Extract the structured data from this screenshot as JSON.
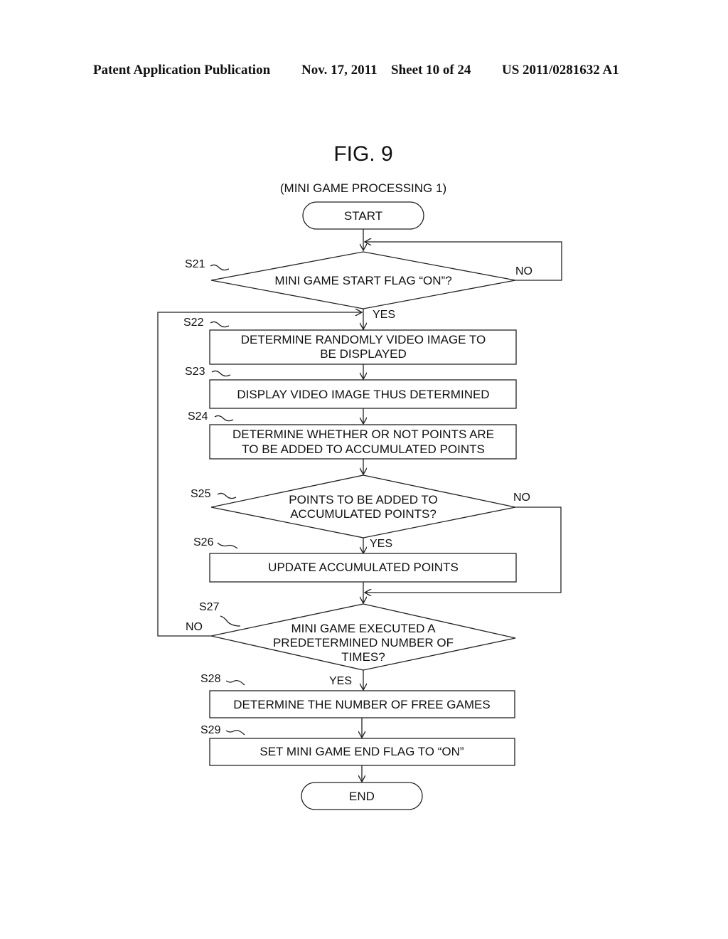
{
  "header": {
    "publication": "Patent Application Publication",
    "date": "Nov. 17, 2011",
    "sheet": "Sheet 10 of 24",
    "number": "US 2011/0281632 A1"
  },
  "figure": {
    "title": "FIG. 9",
    "subtitle": "(MINI GAME PROCESSING 1)"
  },
  "flow": {
    "start": "START",
    "end": "END",
    "steps": {
      "s21": {
        "id": "S21",
        "lines": [
          "MINI GAME START FLAG “ON”?"
        ]
      },
      "s22": {
        "id": "S22",
        "lines": [
          "DETERMINE RANDOMLY VIDEO IMAGE TO",
          "BE DISPLAYED"
        ]
      },
      "s23": {
        "id": "S23",
        "lines": [
          "DISPLAY VIDEO IMAGE THUS DETERMINED"
        ]
      },
      "s24": {
        "id": "S24",
        "lines": [
          "DETERMINE WHETHER OR NOT POINTS ARE",
          "TO BE ADDED TO ACCUMULATED POINTS"
        ]
      },
      "s25": {
        "id": "S25",
        "lines": [
          "POINTS TO BE ADDED TO",
          "ACCUMULATED POINTS?"
        ]
      },
      "s26": {
        "id": "S26",
        "lines": [
          "UPDATE ACCUMULATED POINTS"
        ]
      },
      "s27": {
        "id": "S27",
        "lines": [
          "MINI GAME EXECUTED A",
          "PREDETERMINED NUMBER OF",
          "TIMES?"
        ]
      },
      "s28": {
        "id": "S28",
        "lines": [
          "DETERMINE THE NUMBER OF FREE GAMES"
        ]
      },
      "s29": {
        "id": "S29",
        "lines": [
          "SET MINI GAME END FLAG TO “ON”"
        ]
      }
    },
    "branch_labels": {
      "s21_no": "NO",
      "s21_yes": "YES",
      "s25_no": "NO",
      "s25_yes": "YES",
      "s27_no": "NO",
      "s27_yes": "YES"
    }
  }
}
